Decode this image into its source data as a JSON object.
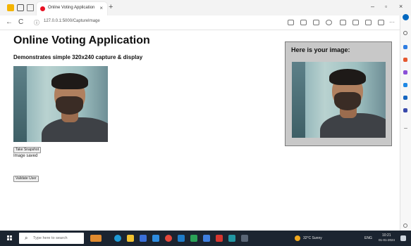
{
  "browser": {
    "tab_title": "Online Voting Application",
    "tab_close": "×",
    "new_tab": "+",
    "url": "127.0.0.1:5000/CaptureImage",
    "back": "←",
    "refresh": "C",
    "info": "ⓘ",
    "minimize": "–",
    "maximize": "▫",
    "close": "×",
    "more": "···"
  },
  "page": {
    "title": "Online Voting Application",
    "subtitle": "Demonstrates simple 320x240 capture & display",
    "take_snapshot_label": "Take Snapshot",
    "status_text": "Image saved",
    "validate_label": "Validate User",
    "result_heading": "Here is your image:"
  },
  "taskbar": {
    "search_placeholder": "Type here to search",
    "weather": "32°C Sunny",
    "time": "10:21",
    "date": "01-01-2024",
    "language": "ENG"
  },
  "colors": {
    "accent": "#0067c0",
    "tab_favicon": "#e81123",
    "result_box": "#c8c8c8",
    "taskbar": "#1b2430"
  }
}
